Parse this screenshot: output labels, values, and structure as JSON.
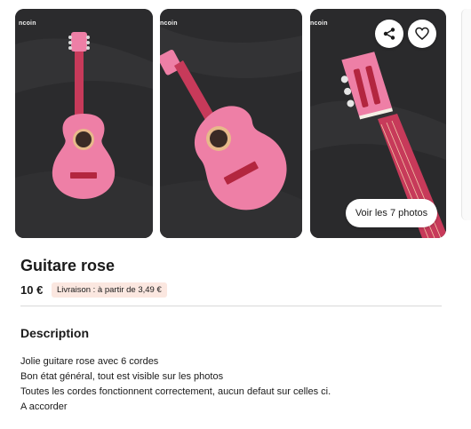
{
  "gallery": {
    "watermark": "ncoin",
    "photos": [
      {
        "alt": "pink guitar photo 1"
      },
      {
        "alt": "pink guitar photo 2"
      },
      {
        "alt": "pink guitar headstock photo 3"
      }
    ],
    "share_icon": "share-icon",
    "favorite_icon": "heart-icon",
    "see_all_label": "Voir les 7 photos"
  },
  "listing": {
    "title": "Guitare rose",
    "price": "10 €",
    "delivery_badge": "Livraison : à partir de 3,49 €"
  },
  "description": {
    "heading": "Description",
    "lines": [
      "Jolie guitare rose avec 6 cordes",
      "Bon état général, tout est visible sur les photos",
      "Toutes les cordes fonctionnent correctement, aucun defaut sur celles ci.",
      "A accorder"
    ]
  },
  "colors": {
    "guitar_pink": "#ee7fa6",
    "background_dark": "#2a2a2c",
    "badge_bg": "#fbe7e0"
  }
}
